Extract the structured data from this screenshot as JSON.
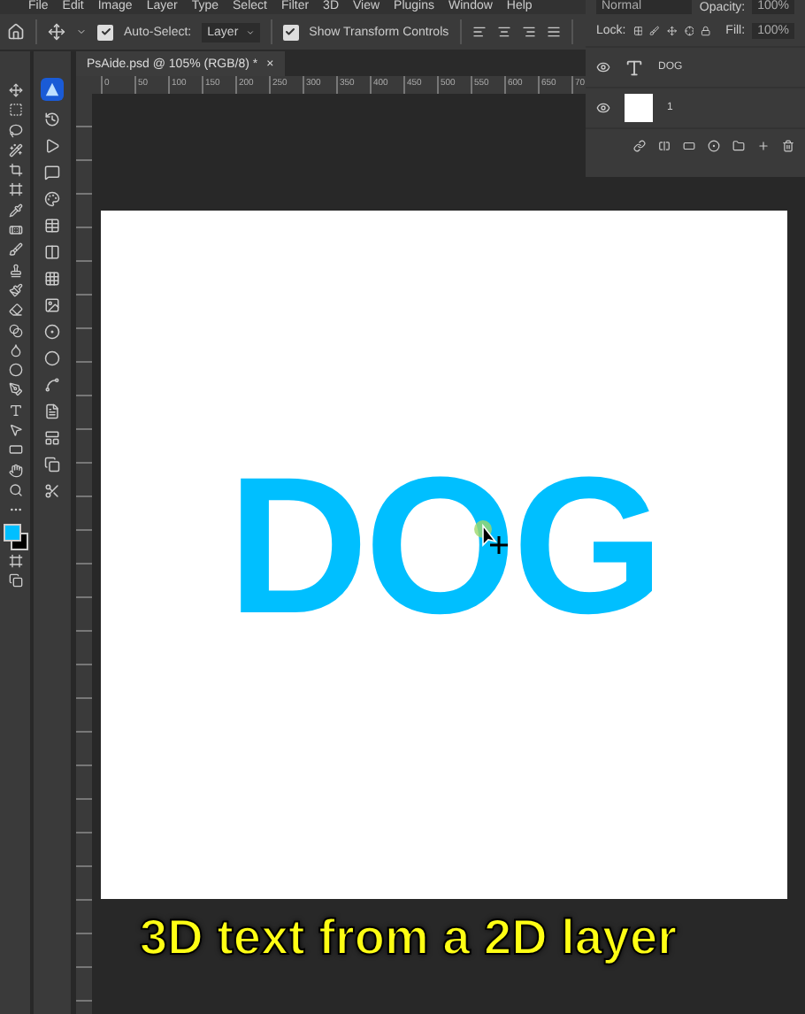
{
  "menu": [
    "File",
    "Edit",
    "Image",
    "Layer",
    "Type",
    "Select",
    "Filter",
    "3D",
    "View",
    "Plugins",
    "Window",
    "Help"
  ],
  "options_bar": {
    "auto_select": {
      "label": "Auto-Select:",
      "checked": true
    },
    "target": "Layer",
    "transform_controls": {
      "label": "Show Transform Controls",
      "checked": true
    }
  },
  "document_tab": {
    "title": "PsAide.psd @ 105% (RGB/8) *",
    "close": "×"
  },
  "ruler": [
    "0",
    "50",
    "100",
    "150",
    "200",
    "250",
    "300",
    "350",
    "400",
    "450",
    "500",
    "550",
    "600",
    "650",
    "70"
  ],
  "layers_panel": {
    "blend_mode": "Normal",
    "opacity_label": "Opacity:",
    "opacity": "100%",
    "lock_label": "Lock:",
    "fill_label": "Fill:",
    "fill": "100%",
    "layers": [
      {
        "kind": "text",
        "name": "DOG",
        "visible": true
      },
      {
        "kind": "pixel",
        "name": "1",
        "visible": true
      }
    ]
  },
  "canvas": {
    "text": "DOG"
  },
  "caption": "3D text from a 2D layer"
}
